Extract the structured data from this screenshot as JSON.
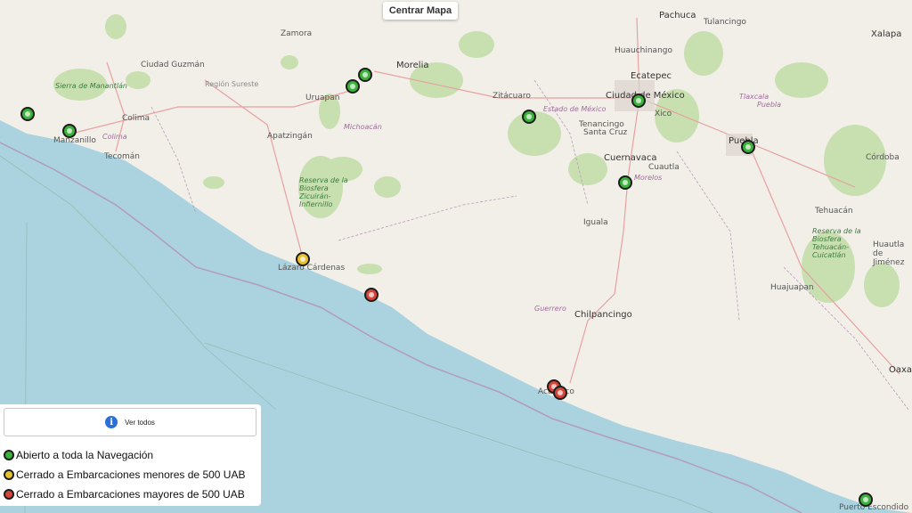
{
  "controls": {
    "center_label": "Centrar Mapa"
  },
  "legend": {
    "view_all_label": "Ver todos",
    "items": [
      {
        "label": "Abierto a toda la Navegación",
        "color": "#3bb33b"
      },
      {
        "label": "Cerrado a Embarcaciones menores de 500 UAB",
        "color": "#e6c12e"
      },
      {
        "label": "Cerrado a Embarcaciones mayores de 500 UAB",
        "color": "#d4453a"
      }
    ]
  },
  "colors": {
    "sea": "#aad3df",
    "land": "#f2efe9",
    "green": "#c8dfb0",
    "road": "#e8a0a0",
    "border": "#b99ab8"
  },
  "places": {
    "pachuca": "Pachuca",
    "tulancingo": "Tulancingo",
    "zamora": "Zamora",
    "morelia": "Morelia",
    "ciudad_guzman": "Ciudad Guzmán",
    "uruapan": "Uruapan",
    "region_sureste": "Región Sureste",
    "sierra_manantlan": "Sierra de Manantlán",
    "colima": "Colima",
    "colima_state": "Colima",
    "manzanillo": "Manzanillo",
    "tecoman": "Tecomán",
    "apatzingan": "Apatzingán",
    "michoacan": "Michoacán",
    "zitacuaro": "Zitácuaro",
    "estado_mexico": "Estado de México",
    "ecatepec": "Ecatepec",
    "ciudad_mexico": "Ciudad de México",
    "xico": "Xico",
    "tlaxcala": "Tlaxcala",
    "puebla_state": "Puebla",
    "puebla": "Puebla",
    "xalapa": "Xalapa",
    "cordoba": "Córdoba",
    "tenancingo": "Tenancingo",
    "santa_cruz": "Santa Cruz",
    "cuernavaca": "Cuernavaca",
    "cuautla": "Cuautla",
    "morelos": "Morelos",
    "reserva_infiernillo": "Reserva de la Biosfera Zicuirán-Infiernillo",
    "lazaro_cardenas": "Lázaro Cárdenas",
    "iguala": "Iguala",
    "tehuacan": "Tehuacán",
    "reserva_tehuacan": "Reserva de la Biosfera Tehuacán-Cuicatlán",
    "huautla": "Huautla de Jiménez",
    "huajuapan": "Huajuapan",
    "guerrero": "Guerrero",
    "chilpancingo": "Chilpancingo",
    "acapulco": "Acapulco",
    "oaxaca": "Oaxaca",
    "puerto_escondido": "Puerto Escondido",
    "huejutla": "Huauchinango"
  },
  "markers": [
    {
      "name": "marker-manzanillo-north",
      "status": "open"
    },
    {
      "name": "marker-manzanillo",
      "status": "open"
    },
    {
      "name": "marker-morelia-1",
      "status": "open"
    },
    {
      "name": "marker-morelia-2",
      "status": "open"
    },
    {
      "name": "marker-estado-mexico",
      "status": "open"
    },
    {
      "name": "marker-ciudad-mexico",
      "status": "open"
    },
    {
      "name": "marker-puebla",
      "status": "open"
    },
    {
      "name": "marker-cuernavaca",
      "status": "open"
    },
    {
      "name": "marker-lazaro-cardenas",
      "status": "closed-small"
    },
    {
      "name": "marker-coast-guerrero",
      "status": "closed-large"
    },
    {
      "name": "marker-acapulco-1",
      "status": "closed-large"
    },
    {
      "name": "marker-acapulco-2",
      "status": "closed-large"
    },
    {
      "name": "marker-puerto-escondido",
      "status": "open"
    }
  ]
}
